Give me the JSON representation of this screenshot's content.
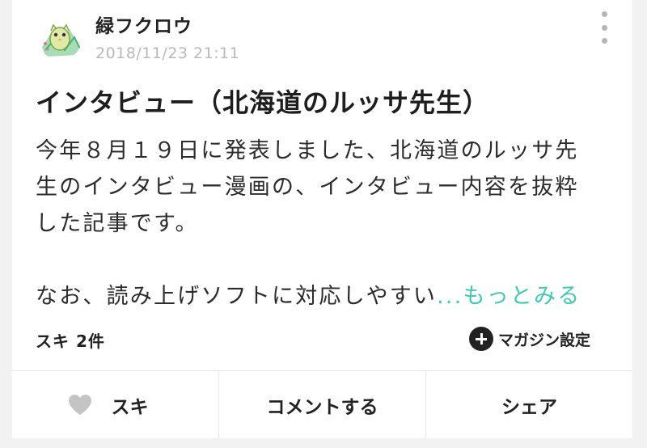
{
  "post": {
    "author": "緑フクロウ",
    "date": "2018/11/23 21:11",
    "title": "インタビュー（北海道のルッサ先生）",
    "body_lines": [
      "今年８月１９日に発表しました、北海道のルッサ先",
      "生のインタビュー漫画の、インタビュー内容を抜粋",
      "した記事です。"
    ],
    "excerpt_tail": "なお、読み上げソフトに対応しやすい",
    "read_more": "...もっとみる",
    "likes_label": "スキ 2件",
    "magazine_label": "マガジン設定"
  },
  "actions": {
    "like": "スキ",
    "comment": "コメントする",
    "share": "シェア"
  },
  "colors": {
    "accent": "#41c9b4",
    "heart": "#c4c4c4",
    "date": "#b9b9b9"
  },
  "icons": {
    "avatar": "owl-avatar",
    "menu": "kebab-menu-icon",
    "magazine": "plus-circle-icon",
    "like": "heart-icon"
  }
}
